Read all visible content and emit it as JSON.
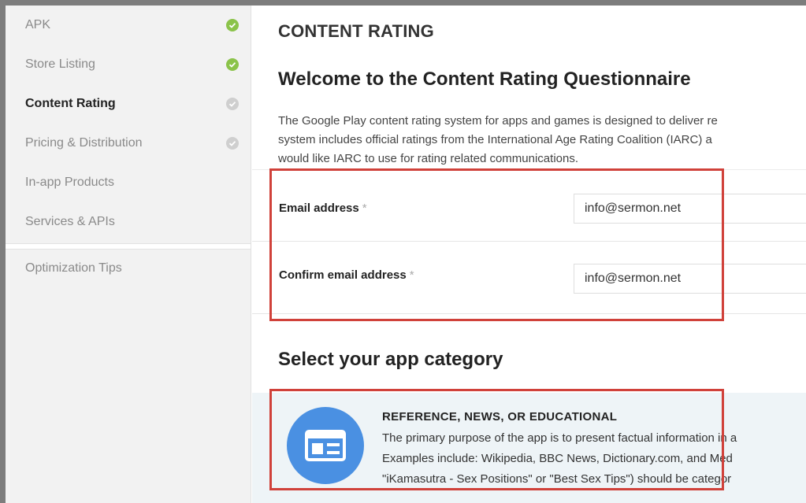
{
  "sidebar": {
    "items": [
      {
        "label": "APK",
        "status": "complete"
      },
      {
        "label": "Store Listing",
        "status": "complete"
      },
      {
        "label": "Content Rating",
        "status": "pending"
      },
      {
        "label": "Pricing & Distribution",
        "status": "pending"
      },
      {
        "label": "In-app Products",
        "status": "none"
      },
      {
        "label": "Services & APIs",
        "status": "none"
      }
    ],
    "tips_label": "Optimization Tips"
  },
  "main": {
    "page_title": "CONTENT RATING",
    "welcome_title": "Welcome to the Content Rating Questionnaire",
    "intro_lines": [
      "The Google Play content rating system for apps and games is designed to deliver re",
      "system includes official ratings from the International Age Rating Coalition (IARC) a",
      "would like IARC to use for rating related communications."
    ],
    "email": {
      "label": "Email address",
      "required_mark": "*",
      "value": "info@sermon.net"
    },
    "confirm_email": {
      "label": "Confirm email address",
      "required_mark": "*",
      "value": "info@sermon.net"
    },
    "category_title": "Select your app category",
    "category": {
      "icon": "newspaper-icon",
      "title": "REFERENCE, NEWS, OR EDUCATIONAL",
      "desc_lines": [
        "The primary purpose of the app is to present factual information in a",
        "Examples include: Wikipedia, BBC News, Dictionary.com, and Med",
        "\"iKamasutra - Sex Positions\" or \"Best Sex Tips\") should be categor"
      ]
    }
  },
  "colors": {
    "sidebar_bg": "#f2f2f2",
    "status_complete": "#8bc34a",
    "status_pending": "#cfcfcf",
    "category_icon_bg": "#4a90e2",
    "category_card_bg": "#eef4f7",
    "highlight_border": "#d0413a"
  }
}
